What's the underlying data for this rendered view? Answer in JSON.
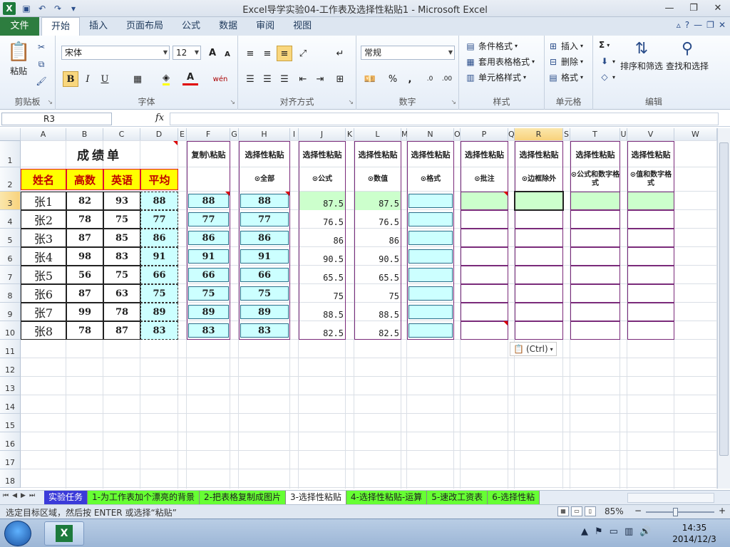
{
  "window": {
    "title": "Excel导学实验04-工作表及选择性粘贴1  -  Microsoft Excel",
    "app_letter": "X"
  },
  "ribbon_tabs": {
    "file": "文件",
    "items": [
      "开始",
      "插入",
      "页面布局",
      "公式",
      "数据",
      "审阅",
      "视图"
    ]
  },
  "clipboard": {
    "paste": "粘贴",
    "label": "剪贴板"
  },
  "font": {
    "name": "宋体",
    "size": "12",
    "label": "字体",
    "bold": "B",
    "italic": "I",
    "underline": "U",
    "grow": "A",
    "shrink": "A",
    "font_color": "A",
    "phonetic": "wén"
  },
  "alignment": {
    "label": "对齐方式"
  },
  "number": {
    "format": "常规",
    "label": "数字",
    "percent": "%",
    "comma": ","
  },
  "styles": {
    "label": "样式",
    "conditional": "条件格式",
    "table": "套用表格格式",
    "cell": "单元格样式"
  },
  "cells": {
    "label": "单元格",
    "insert": "插入",
    "delete": "删除",
    "format": "格式"
  },
  "editing": {
    "label": "编辑",
    "sort": "排序和筛选",
    "find": "查找和选择",
    "sigma": "Σ"
  },
  "formula_bar": {
    "name_box": "R3",
    "fx": "fx",
    "value": ""
  },
  "columns": [
    "A",
    "B",
    "C",
    "D",
    "E",
    "F",
    "G",
    "H",
    "I",
    "J",
    "K",
    "L",
    "M",
    "N",
    "O",
    "P",
    "Q",
    "R",
    "S",
    "T",
    "U",
    "V",
    "W"
  ],
  "rows": [
    "1",
    "2",
    "3",
    "4",
    "5",
    "6",
    "7",
    "8",
    "9",
    "10",
    "11",
    "12",
    "13",
    "14",
    "15",
    "16",
    "17",
    "18"
  ],
  "table": {
    "title": "成绩单",
    "headers": [
      "姓名",
      "高数",
      "英语",
      "平均"
    ],
    "students": [
      {
        "name": "张1",
        "math": "82",
        "eng": "93",
        "avg": "88"
      },
      {
        "name": "张2",
        "math": "78",
        "eng": "75",
        "avg": "77"
      },
      {
        "name": "张3",
        "math": "87",
        "eng": "85",
        "avg": "86"
      },
      {
        "name": "张4",
        "math": "98",
        "eng": "83",
        "avg": "91"
      },
      {
        "name": "张5",
        "math": "56",
        "eng": "75",
        "avg": "66"
      },
      {
        "name": "张6",
        "math": "87",
        "eng": "63",
        "avg": "75"
      },
      {
        "name": "张7",
        "math": "99",
        "eng": "78",
        "avg": "89"
      },
      {
        "name": "张8",
        "math": "78",
        "eng": "87",
        "avg": "83"
      }
    ]
  },
  "paste_sections": {
    "copy_header": "复制\\粘贴",
    "select_header": "选择性粘贴",
    "options": [
      "⊙全部",
      "⊙公式",
      "⊙数值",
      "⊙格式",
      "⊙批注",
      "⊙边框除外",
      "⊙公式和数字格式",
      "⊙值和数字格式"
    ],
    "f_values": [
      "88",
      "77",
      "86",
      "91",
      "66",
      "75",
      "89",
      "83"
    ],
    "h_values": [
      "88",
      "77",
      "86",
      "91",
      "66",
      "75",
      "89",
      "83"
    ],
    "j_values": [
      "87.5",
      "76.5",
      "86",
      "90.5",
      "65.5",
      "75",
      "88.5",
      "82.5"
    ],
    "l_values": [
      "87.5",
      "76.5",
      "86",
      "90.5",
      "65.5",
      "75",
      "88.5",
      "82.5"
    ]
  },
  "paste_options_tag": "(Ctrl)",
  "sheet_tabs": [
    "实验任务",
    "1-为工作表加个漂亮的背景",
    "2-把表格复制成图片",
    "3-选择性粘贴",
    "4-选择性粘贴-运算",
    "5-速改工资表",
    "6-选择性粘"
  ],
  "status": {
    "message": "选定目标区域，然后按 ENTER 或选择“粘贴”",
    "zoom": "85%",
    "minus": "−",
    "plus": "+"
  },
  "taskbar": {
    "time": "14:35",
    "date": "2014/12/3"
  }
}
